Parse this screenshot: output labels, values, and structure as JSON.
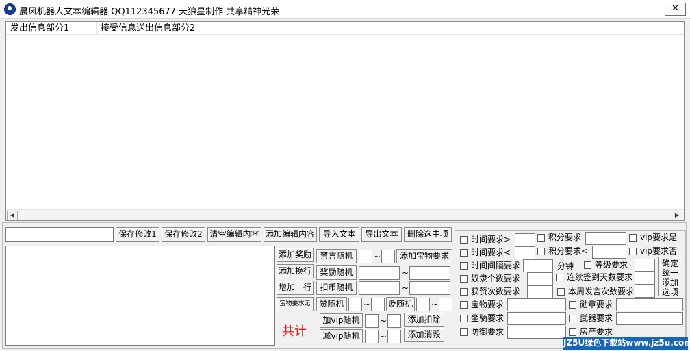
{
  "window": {
    "title": "晨风机器人文本编辑器    QQ112345677 天狼星制作    共享精神光荣",
    "close_glyph": "✕"
  },
  "list": {
    "columns": [
      "发出信息部分1",
      "接受信息送出信息部分2"
    ],
    "scroll_left": "◀",
    "scroll_right": "▶"
  },
  "toolbar": {
    "save1": "保存修改1",
    "save2": "保存修改2",
    "clear": "清空编辑内容",
    "add_edit": "添加编辑内容",
    "import": "导入文本",
    "export": "导出文本",
    "delete": "删除选中项"
  },
  "left_buttons": {
    "add_reward": "添加奖励",
    "add_newline": "添加换行",
    "add_line": "增加一行",
    "treasure_req_none": "宝物要求无"
  },
  "mid": {
    "ban_random": "禁言随机",
    "add_treasure_req": "添加宝物要求",
    "reward_random": "奖励随机",
    "deduct_random": "扣币随机",
    "like_random": "赞随机",
    "dislike_random": "贬随机",
    "add_vip_random": "加vip随机",
    "add_deduct": "添加扣除",
    "reduce_vip_random": "减vip随机",
    "add_consume": "添加消毁",
    "tilde": "~"
  },
  "total_label": "共计",
  "right_panel": {
    "time_gt": "时间要求>",
    "time_lt": "时间要求<",
    "interval": "时间间隔要求",
    "minutes": "分钟",
    "slave_count": "奴隶个数要求",
    "like_count": "获赞次数要求",
    "treasure": "宝物要求",
    "mount": "坐骑要求",
    "defense": "防御要求",
    "points": "积分要求",
    "points_lt": "积分要求<",
    "level": "等级要求",
    "consecutive_sign": "连续签到天数要求",
    "weekly_speech": "本周发言次数要求",
    "medal": "勋章要求",
    "weapon": "武器要求",
    "house": "房产要求",
    "vip_yes": "vip要求是",
    "vip_no": "vip要求否",
    "confirm_add": "确定统一添加选项"
  },
  "watermark": "JZ5U绿色下载站www.jz5u.com"
}
